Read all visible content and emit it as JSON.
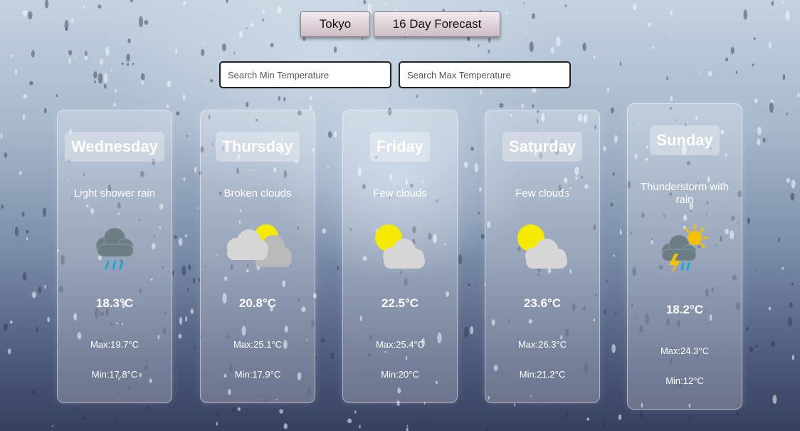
{
  "nav": {
    "city_label": "Tokyo",
    "forecast_label": "16 Day Forecast"
  },
  "search": {
    "min_placeholder": "Search Min Temperature",
    "max_placeholder": "Search Max Temperature"
  },
  "days": [
    {
      "day": "Wednesday",
      "description": "Light shower rain",
      "temp": "18.3°C",
      "max": "Max:19.7°C",
      "min": "Min:17.8°C",
      "icon": "shower-rain-icon"
    },
    {
      "day": "Thursday",
      "description": "Broken clouds",
      "temp": "20.8°C",
      "max": "Max:25.1°C",
      "min": "Min:17.9°C",
      "icon": "broken-clouds-icon"
    },
    {
      "day": "Friday",
      "description": "Few clouds",
      "temp": "22.5°C",
      "max": "Max:25.4°C",
      "min": "Min:20°C",
      "icon": "few-clouds-icon"
    },
    {
      "day": "Saturday",
      "description": "Few clouds",
      "temp": "23.6°C",
      "max": "Max:26.3°C",
      "min": "Min:21.2°C",
      "icon": "few-clouds-icon"
    },
    {
      "day": "Sunday",
      "description": "Thunderstorm with rain",
      "temp": "18.2°C",
      "max": "Max:24.3°C",
      "min": "Min:12°C",
      "icon": "thunderstorm-icon"
    }
  ],
  "colors": {
    "sun": "#f5ea00",
    "cloud": "#d6d6d6",
    "rain_cloud": "#6c7d86",
    "rain": "#1aa6d6",
    "lightning": "#f3c100"
  }
}
